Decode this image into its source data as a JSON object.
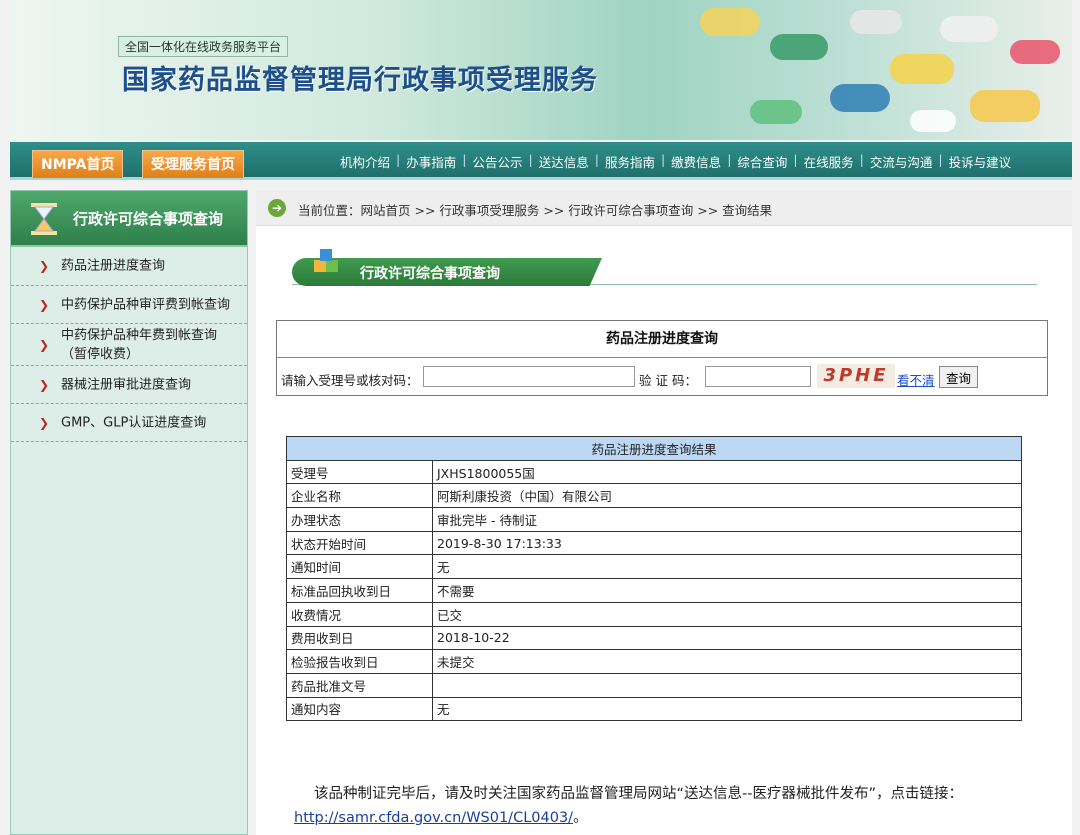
{
  "banner": {
    "tagline": "全国一体化在线政务服务平台",
    "title": "国家药品监督管理局行政事项受理服务"
  },
  "nav": {
    "btn_home": "NMPA首页",
    "btn_service": "受理服务首页",
    "links": [
      "机构介绍",
      "办事指南",
      "公告公示",
      "送达信息",
      "服务指南",
      "缴费信息",
      "综合查询",
      "在线服务",
      "交流与沟通",
      "投诉与建议"
    ],
    "sep": "|"
  },
  "sidebar": {
    "title": "行政许可综合事项查询",
    "items": [
      {
        "label": "药品注册进度查询"
      },
      {
        "label": "中药保护品种审评费到帐查询"
      },
      {
        "label": "中药保护品种年费到帐查询（暂停收费）"
      },
      {
        "label": "器械注册审批进度查询"
      },
      {
        "label": "GMP、GLP认证进度查询"
      }
    ],
    "arrow": "❯"
  },
  "breadcrumb": {
    "text": "当前位置：网站首页 >> 行政事项受理服务 >> 行政许可综合事项查询 >> 查询结果"
  },
  "section": {
    "title": "行政许可综合事项查询"
  },
  "query": {
    "title": "药品注册进度查询",
    "accept_label": "请输入受理号或核对码：",
    "accept_value": "",
    "code_label": "验 证 码：",
    "code_value": "",
    "captcha": "3PHE",
    "cant_see": "看不清",
    "submit": "查询"
  },
  "result": {
    "title": "药品注册进度查询结果",
    "rows": [
      {
        "k": "受理号",
        "v": "JXHS1800055国"
      },
      {
        "k": "企业名称",
        "v": "阿斯利康投资（中国）有限公司"
      },
      {
        "k": "办理状态",
        "v": "审批完毕 - 待制证"
      },
      {
        "k": "状态开始时间",
        "v": "2019-8-30 17:13:33"
      },
      {
        "k": "通知时间",
        "v": "无"
      },
      {
        "k": "标准品回执收到日",
        "v": "不需要"
      },
      {
        "k": "收费情况",
        "v": "已交"
      },
      {
        "k": "费用收到日",
        "v": "2018-10-22"
      },
      {
        "k": "检验报告收到日",
        "v": "未提交"
      },
      {
        "k": "药品批准文号",
        "v": ""
      },
      {
        "k": "通知内容",
        "v": "无"
      }
    ]
  },
  "note": {
    "text": "该品种制证完毕后，请及时关注国家药品监督管理局网站“送达信息--医疗器械批件发布”，点击链接：",
    "link": "http://samr.cfda.gov.cn/WS01/CL0403/",
    "end": "。"
  }
}
